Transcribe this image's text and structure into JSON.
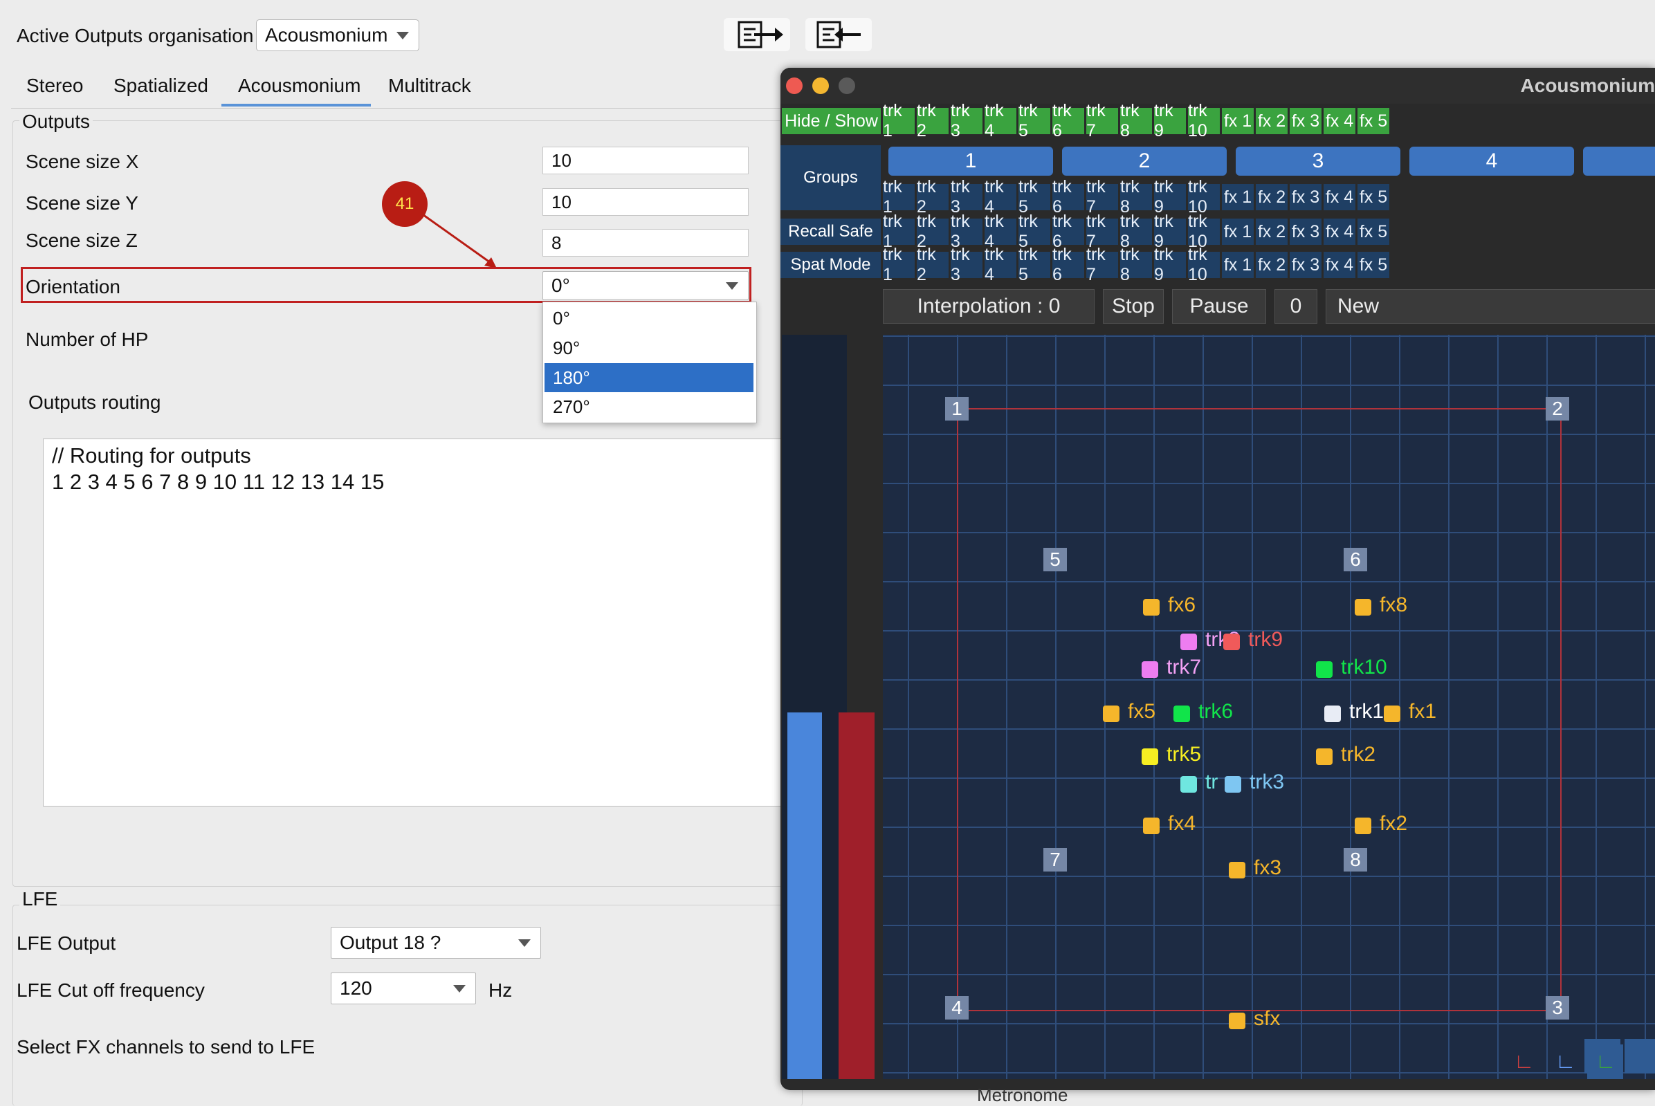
{
  "left_panel": {
    "active_outputs_label": "Active Outputs organisation",
    "active_outputs_value": "Acousmonium",
    "tabs": [
      "Stereo",
      "Spatialized",
      "Acousmonium",
      "Multitrack"
    ],
    "outputs_group": "Outputs",
    "scene_x_label": "Scene size X",
    "scene_x_value": "10",
    "scene_y_label": "Scene size Y",
    "scene_y_value": "10",
    "scene_z_label": "Scene size Z",
    "scene_z_value": "8",
    "orientation_label": "Orientation",
    "orientation_value": "0°",
    "orientation_options": [
      "0°",
      "90°",
      "180°",
      "270°"
    ],
    "annotation_badge": "41",
    "num_hp_label": "Number of HP",
    "routing_label": "Outputs routing",
    "routing_line1": "// Routing for outputs",
    "routing_line2": "1 2 3 4 5 6 7 8 9 10 11 12 13 14 15",
    "lfe_group": "LFE",
    "lfe_output_label": "LFE Output",
    "lfe_output_value": "Output 18 ?",
    "lfe_cut_label": "LFE Cut off frequency",
    "lfe_cut_value": "120",
    "lfe_cut_unit": "Hz",
    "fx_lfe_label": "Select FX channels to send to LFE"
  },
  "acousmonium": {
    "title": "Acousmonium",
    "hide_show": "Hide / Show",
    "groups_label": "Groups",
    "recall_safe": "Recall Safe",
    "spat_mode": "Spat Mode",
    "channels": [
      "trk 1",
      "trk 2",
      "trk 3",
      "trk 4",
      "trk 5",
      "trk 6",
      "trk 7",
      "trk 8",
      "trk 9",
      "trk 10",
      "fx 1",
      "fx 2",
      "fx 3",
      "fx 4",
      "fx 5"
    ],
    "group_numbers": [
      "1",
      "2",
      "3",
      "4"
    ],
    "interpolation": "Interpolation : 0",
    "stop": "Stop",
    "pause": "Pause",
    "counter": "0",
    "new": "New",
    "speakers": [
      "1",
      "2",
      "3",
      "4",
      "5",
      "6",
      "7",
      "8"
    ],
    "sources": [
      "fx6",
      "fx8",
      "trk8",
      "trk9",
      "trk7",
      "trk10",
      "fx5",
      "trk6",
      "trk1",
      "fx1",
      "trk5",
      "trk2",
      "tr",
      "trk3",
      "fx4",
      "fx2",
      "fx3",
      "sfx"
    ],
    "metronome": "Metronome",
    "colors": {
      "green": "#3aa33f",
      "blue_button": "#1f3f64",
      "grid_bg": "#1d2b43",
      "yellow": "#f5b62b",
      "red_line": "#b0333b"
    }
  }
}
